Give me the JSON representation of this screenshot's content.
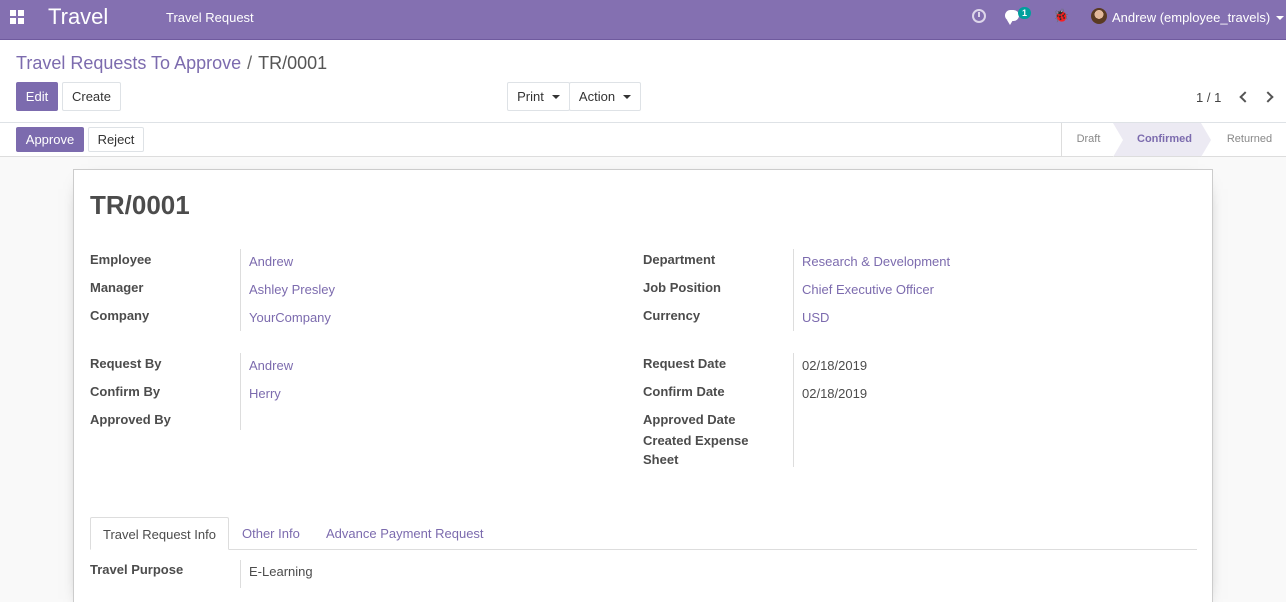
{
  "navbar": {
    "brand": "Travel",
    "menu_item": "Travel Request",
    "chat_badge": "1",
    "user_name": "Andrew (employee_travels)",
    "icons": [
      "apps-icon",
      "clock-icon",
      "chat-icon",
      "bug-icon",
      "avatar"
    ]
  },
  "breadcrumb": {
    "parent": "Travel Requests To Approve",
    "separator": "/",
    "current": "TR/0001"
  },
  "buttons": {
    "edit": "Edit",
    "create": "Create",
    "print": "Print",
    "action": "Action",
    "approve": "Approve",
    "reject": "Reject"
  },
  "pager": {
    "value": "1 / 1"
  },
  "stages": [
    {
      "label": "Draft",
      "active": false
    },
    {
      "label": "Confirmed",
      "active": true
    },
    {
      "label": "Returned",
      "active": false
    }
  ],
  "record": {
    "name": "TR/0001",
    "left_group1": [
      {
        "label": "Employee",
        "value": "Andrew"
      },
      {
        "label": "Manager",
        "value": "Ashley Presley"
      },
      {
        "label": "Company",
        "value": "YourCompany"
      }
    ],
    "right_group1": [
      {
        "label": "Department",
        "value": "Research & Development"
      },
      {
        "label": "Job Position",
        "value": "Chief Executive Officer"
      },
      {
        "label": "Currency",
        "value": "USD"
      }
    ],
    "left_group2": [
      {
        "label": "Request By",
        "value": "Andrew"
      },
      {
        "label": "Confirm By",
        "value": "Herry"
      },
      {
        "label": "Approved By",
        "value": ""
      }
    ],
    "right_group2": [
      {
        "label": "Request Date",
        "value": "02/18/2019"
      },
      {
        "label": "Confirm Date",
        "value": "02/18/2019"
      },
      {
        "label": "Approved Date",
        "value": ""
      },
      {
        "label": "Created Expense Sheet",
        "value": ""
      }
    ]
  },
  "tabs": [
    {
      "label": "Travel Request Info",
      "active": true
    },
    {
      "label": "Other Info",
      "active": false
    },
    {
      "label": "Advance Payment Request",
      "active": false
    }
  ],
  "tab_content": {
    "travel_purpose_label": "Travel Purpose",
    "travel_purpose_value": "E-Learning"
  },
  "colors": {
    "navbar": "#8470b1",
    "accent": "#7c6bae"
  }
}
